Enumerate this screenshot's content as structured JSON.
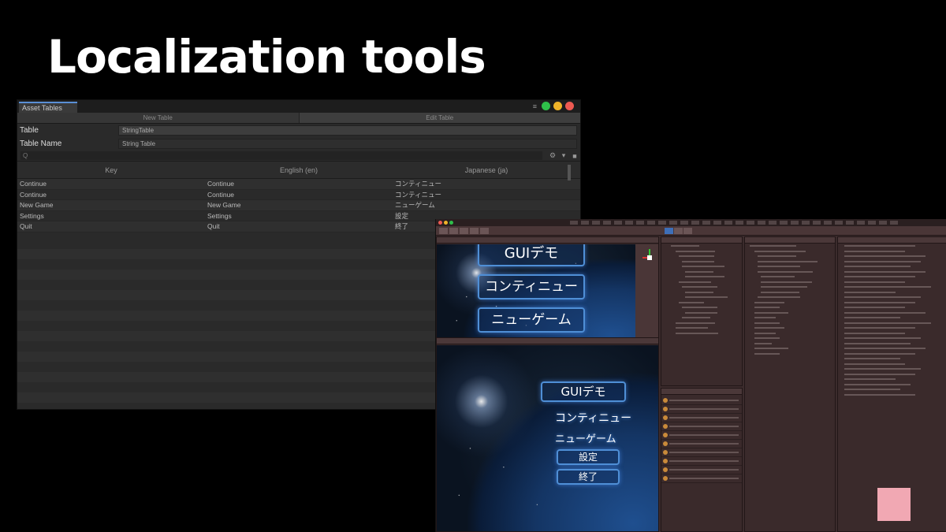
{
  "slide": {
    "title": "Localization tools"
  },
  "asset_tables": {
    "tab_label": "Asset Tables",
    "toolbar": [
      "New Table",
      "Edit Table"
    ],
    "fields": [
      {
        "label": "Table",
        "value": "StringTable"
      },
      {
        "label": "Table Name",
        "value": "String Table"
      }
    ],
    "search_placeholder": "Q",
    "columns": [
      "Key",
      "English (en)",
      "Japanese (ja)"
    ],
    "rows": [
      [
        "Continue",
        "Continue",
        "コンティニュー"
      ],
      [
        "Continue",
        "Continue",
        "コンティニュー"
      ],
      [
        "New Game",
        "New Game",
        "ニューゲーム"
      ],
      [
        "Settings",
        "Settings",
        "設定"
      ],
      [
        "Quit",
        "Quit",
        "終了"
      ]
    ],
    "colors": {
      "accent": "#5a8fd6",
      "bg": "#2a2a2a"
    }
  },
  "game_view_top": {
    "buttons": [
      "GUIデモ",
      "コンティニュー",
      "ニューゲーム"
    ]
  },
  "game_view_bottom": {
    "buttons": [
      "GUIデモ",
      "コンティニュー",
      "ニューゲーム",
      "設定",
      "終了"
    ]
  },
  "unity_editor": {
    "theme_color": "#3b2b2c",
    "swatch_color": "#f1a8b3"
  }
}
